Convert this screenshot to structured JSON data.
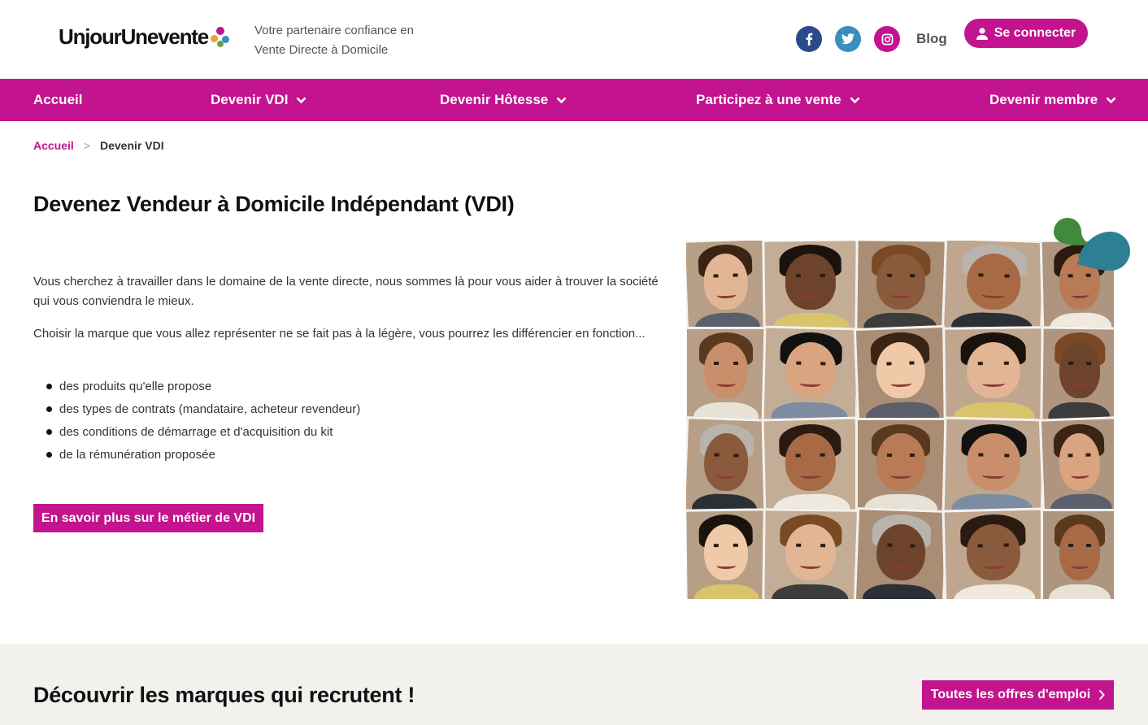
{
  "brand": {
    "logo_text": "UnjourUnevente",
    "tagline_line1": "Votre partenaire confiance en",
    "tagline_line2": "Vente Directe à Domicile",
    "accent_color": "#c3138f"
  },
  "header": {
    "social": [
      {
        "name": "facebook",
        "icon": "facebook-icon",
        "glyph": "f",
        "color": "#2b4a8c"
      },
      {
        "name": "twitter",
        "icon": "twitter-icon",
        "glyph": "t",
        "color": "#3a8fbf"
      },
      {
        "name": "instagram",
        "icon": "instagram-icon",
        "glyph": "◎",
        "color": "#c3138f"
      }
    ],
    "blog_label": "Blog",
    "login_label": "Se connecter",
    "login_icon": "user-icon"
  },
  "nav": {
    "items": [
      {
        "label": "Accueil",
        "dropdown": false
      },
      {
        "label": "Devenir VDI",
        "dropdown": true
      },
      {
        "label": "Devenir Hôtesse",
        "dropdown": true
      },
      {
        "label": "Participez à une vente",
        "dropdown": true
      },
      {
        "label": "Devenir membre",
        "dropdown": true
      }
    ]
  },
  "breadcrumb": {
    "home": "Accueil",
    "separator": ">",
    "current": "Devenir VDI"
  },
  "main": {
    "title": "Devenez Vendeur à Domicile Indépendant (VDI)",
    "paragraph1": "Vous cherchez à travailler dans le domaine de la vente directe, nous sommes là pour vous aider à trouver la société qui vous conviendra le mieux.",
    "paragraph2": "Choisir la marque que vous allez représenter ne se fait pas à la légère, vous pourrez les différencier en fonction...",
    "bullets": [
      "des produits qu'elle propose",
      "des types de contrats (mandataire, acheteur revendeur)",
      "des conditions de démarrage et d'acquisition du kit",
      "de la rémunération proposée"
    ],
    "cta_label": "En savoir plus sur le métier de VDI",
    "collage_description_icon": "portraits-collage"
  },
  "section2": {
    "title": "Découvrir les marques qui recrutent !",
    "offers_label": "Toutes les offres d'emploi",
    "offers_icon": "chevron-right-icon"
  }
}
